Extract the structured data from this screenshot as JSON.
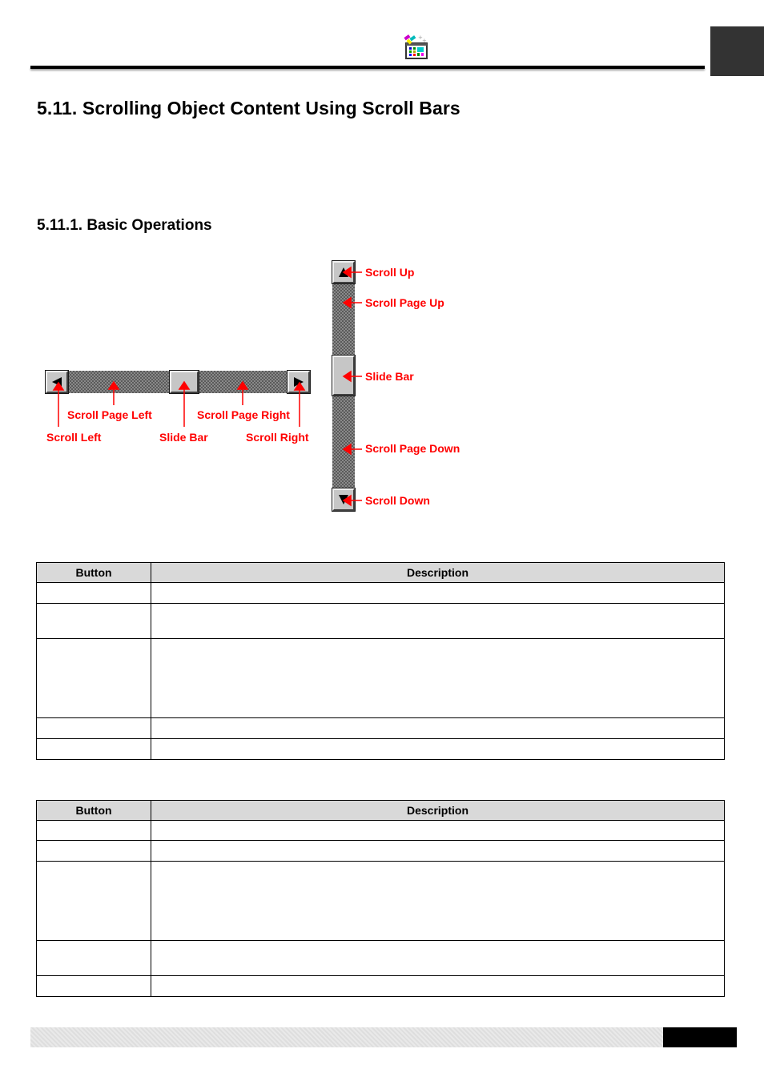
{
  "header": {
    "icon": "app-palette-icon",
    "colors": {
      "rule": "#000000",
      "tab": "#333333"
    }
  },
  "section": {
    "title": "5.11.  Scrolling Object Content Using Scroll Bars",
    "subsection_title": "5.11.1. Basic Operations"
  },
  "figure": {
    "horizontal": {
      "labels": {
        "scroll_page_left": "Scroll Page Left",
        "scroll_page_right": "Scroll Page Right",
        "scroll_left": "Scroll Left",
        "slide_bar": "Slide Bar",
        "scroll_right": "Scroll Right"
      },
      "icons": {
        "left": "arrow-left-icon",
        "right": "arrow-right-icon"
      }
    },
    "vertical": {
      "labels": {
        "scroll_up": "Scroll Up",
        "scroll_page_up": "Scroll Page Up",
        "slide_bar": "Slide Bar",
        "scroll_page_down": "Scroll Page Down",
        "scroll_down": "Scroll Down"
      },
      "icons": {
        "up": "arrow-up-icon",
        "down": "arrow-down-icon"
      }
    },
    "annotation_color": "#ff0000"
  },
  "tables": [
    {
      "headers": [
        "Button",
        "Description"
      ],
      "rows": [
        [
          "",
          ""
        ],
        [
          "",
          ""
        ],
        [
          "",
          ""
        ],
        [
          "",
          ""
        ],
        [
          "",
          ""
        ]
      ]
    },
    {
      "headers": [
        "Button",
        "Description"
      ],
      "rows": [
        [
          "",
          ""
        ],
        [
          "",
          ""
        ],
        [
          "",
          ""
        ],
        [
          "",
          ""
        ],
        [
          "",
          ""
        ]
      ]
    }
  ],
  "footer": {
    "colors": {
      "bar": "#e4e4e4",
      "page_box": "#000000"
    }
  }
}
